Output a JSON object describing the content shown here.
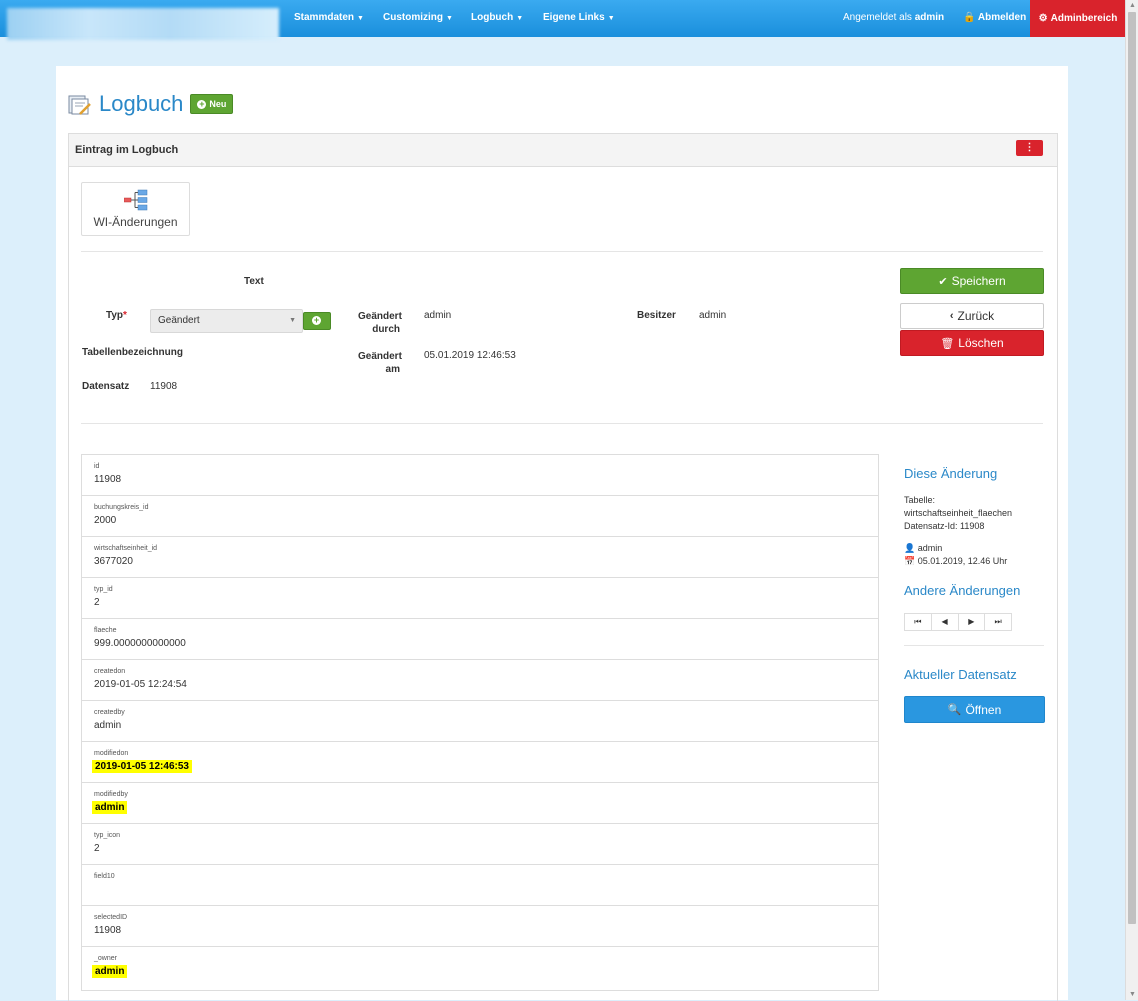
{
  "nav": {
    "items": [
      {
        "label": "Stammdaten"
      },
      {
        "label": "Customizing"
      },
      {
        "label": "Logbuch"
      },
      {
        "label": "Eigene Links"
      }
    ],
    "logged_in_prefix": "Angemeldet als",
    "logged_in_user": "admin",
    "logout_label": "Abmelden",
    "admin_label": "Adminbereich"
  },
  "page": {
    "title": "Logbuch",
    "new_label": "Neu"
  },
  "panel": {
    "title": "Eintrag im Logbuch",
    "kebab": "⋮",
    "wi_label": "WI-Änderungen"
  },
  "form": {
    "text_label": "Text",
    "typ_label": "Typ",
    "typ_required": "*",
    "typ_value": "Geändert",
    "geaendert_durch_label_1": "Geändert",
    "geaendert_durch_label_2": "durch",
    "geaendert_durch_value": "admin",
    "besitzer_label": "Besitzer",
    "besitzer_value": "admin",
    "tabellen_label": "Tabellenbezeichnung",
    "geaendert_am_label_1": "Geändert",
    "geaendert_am_label_2": "am",
    "geaendert_am_value": "05.01.2019 12:46:53",
    "datensatz_label": "Datensatz",
    "datensatz_value": "11908"
  },
  "actions": {
    "save": "Speichern",
    "back": "Zurück",
    "delete": "Löschen"
  },
  "fields": [
    {
      "name": "id",
      "value": "11908",
      "highlight": false
    },
    {
      "name": "buchungskreis_id",
      "value": "2000",
      "highlight": false
    },
    {
      "name": "wirtschaftseinheit_id",
      "value": "3677020",
      "highlight": false
    },
    {
      "name": "typ_id",
      "value": "2",
      "highlight": false
    },
    {
      "name": "flaeche",
      "value": "999.0000000000000",
      "highlight": false
    },
    {
      "name": "createdon",
      "value": "2019-01-05 12:24:54",
      "highlight": false
    },
    {
      "name": "createdby",
      "value": "admin",
      "highlight": false
    },
    {
      "name": "modifiedon",
      "value": "2019-01-05 12:46:53",
      "highlight": true
    },
    {
      "name": "modifiedby",
      "value": "admin",
      "highlight": true
    },
    {
      "name": "typ_icon",
      "value": "2",
      "highlight": false
    },
    {
      "name": "field10",
      "value": "",
      "highlight": false
    },
    {
      "name": "selectedID",
      "value": "11908",
      "highlight": false
    },
    {
      "name": "_owner",
      "value": "admin",
      "highlight": true
    }
  ],
  "side": {
    "this_change_title": "Diese Änderung",
    "table_label": "Tabelle:",
    "table_value": "wirtschaftseinheit_flaechen",
    "record_label": "Datensatz-Id: 11908",
    "user": "admin",
    "date": "05.01.2019, 12.46 Uhr",
    "other_changes_title": "Andere Änderungen",
    "pager": [
      "⏮",
      "◀",
      "▶",
      "⏭"
    ],
    "current_title": "Aktueller Datensatz",
    "open_label": "Öffnen"
  },
  "colors": {
    "nav": "#1a8fdc",
    "admin": "#d9232c",
    "save": "#5ea532",
    "delete": "#d9232c",
    "open": "#2a97e0",
    "highlight": "#ffff00"
  }
}
